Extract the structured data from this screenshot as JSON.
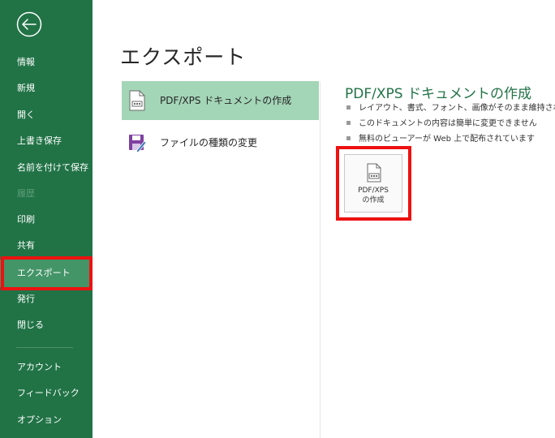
{
  "sidebar": {
    "items": [
      {
        "label": "情報"
      },
      {
        "label": "新規"
      },
      {
        "label": "開く"
      },
      {
        "label": "上書き保存"
      },
      {
        "label": "名前を付けて保存"
      },
      {
        "label": "履歴",
        "disabled": true
      },
      {
        "label": "印刷"
      },
      {
        "label": "共有"
      },
      {
        "label": "エクスポート",
        "selected": true
      },
      {
        "label": "発行"
      },
      {
        "label": "閉じる"
      }
    ],
    "bottom_items": [
      {
        "label": "アカウント"
      },
      {
        "label": "フィードバック"
      },
      {
        "label": "オプション"
      }
    ]
  },
  "main": {
    "title": "エクスポート",
    "options": [
      {
        "label": "PDF/XPS ドキュメントの作成",
        "icon": "pdf-document-icon",
        "selected": true
      },
      {
        "label": "ファイルの種類の変更",
        "icon": "save-as-edit-icon"
      }
    ]
  },
  "detail": {
    "title": "PDF/XPS ドキュメントの作成",
    "bullets": [
      "レイアウト、書式、フォント、画像がそのまま維持されます",
      "このドキュメントの内容は簡単に変更できません",
      "無料のビューアーが Web 上で配布されています"
    ],
    "button": {
      "line1": "PDF/XPS",
      "line2": "の作成"
    }
  },
  "colors": {
    "sidebar_bg": "#217346",
    "sidebar_selected": "#439467",
    "option_selected": "#a3d5b7",
    "accent_text": "#217346",
    "highlight": "#ee1111"
  }
}
